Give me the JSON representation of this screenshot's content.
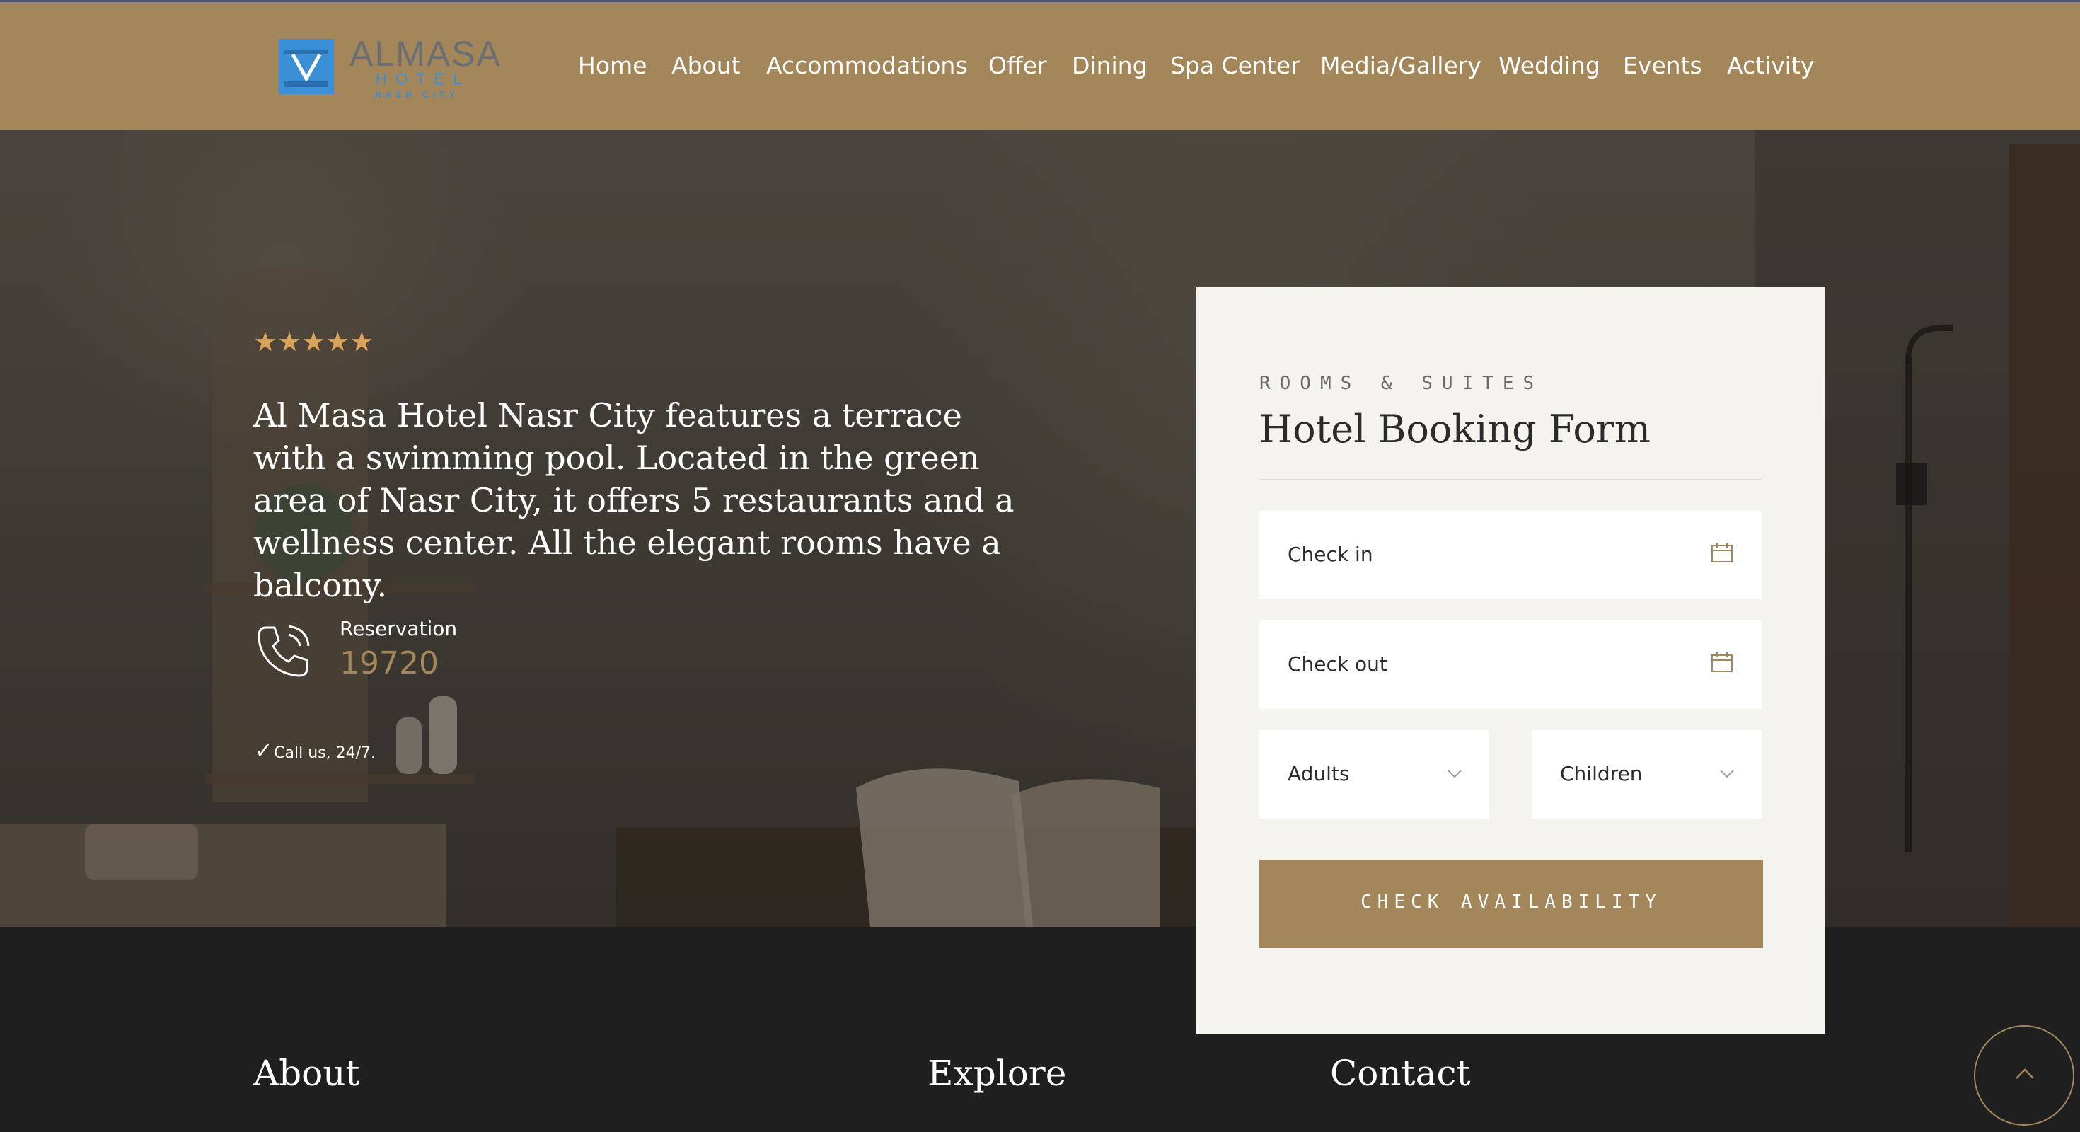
{
  "header": {
    "logo": {
      "name": "ALMASA",
      "line2": "HOTEL",
      "line3": "NASR CITY"
    },
    "nav": [
      "Home",
      "About",
      "Accommodations",
      "Offer",
      "Dining",
      "Spa Center",
      "Media/Gallery",
      "Wedding",
      "Events",
      "Activity"
    ]
  },
  "hero": {
    "stars": "★★★★★",
    "intro": "Al Masa Hotel Nasr City features a terrace with a swimming pool. Located in the green area of Nasr City, it offers 5 restaurants and a wellness center. All the elegant rooms have a balcony.",
    "reservation_label": "Reservation",
    "reservation_number": "19720",
    "call_note": "Call us, 24/7."
  },
  "booking": {
    "eyebrow": "ROOMS & SUITES",
    "title": "Hotel Booking Form",
    "check_in": "Check in",
    "check_out": "Check out",
    "adults": "Adults",
    "children": "Children",
    "button": "CHECK AVAILABILITY"
  },
  "footer": {
    "about": "About",
    "explore": "Explore",
    "contact": "Contact"
  },
  "colors": {
    "accent": "#a3865a",
    "header_bg": "#a3865a",
    "footer_bg": "#1f1f1f",
    "card_bg": "#f5f3ee",
    "logo_blue": "#3b8fd6"
  },
  "icons": [
    "logo-mark-icon",
    "phone-icon",
    "check-icon",
    "calendar-icon",
    "chevron-down-icon",
    "chevron-up-icon"
  ]
}
